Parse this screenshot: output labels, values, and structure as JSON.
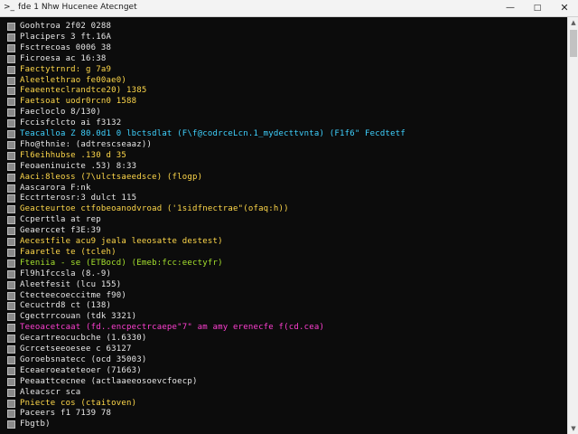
{
  "window": {
    "title": "fde 1 Nhw Hucenee Atecnget",
    "app_icon": "terminal-icon",
    "minimize_icon": "minimize-icon",
    "maximize_icon": "maximize-icon",
    "close_icon": "close-icon"
  },
  "terminal": {
    "lines": [
      {
        "text": "Goohtroa  2f02  0288",
        "color": "#e8e8e8"
      },
      {
        "text": "Placipers  3  ft.16A",
        "color": "#e8e8e8"
      },
      {
        "text": "Fsctrecoas  0006  38",
        "color": "#e8e8e8"
      },
      {
        "text": "Ficroesa  ac  16:38",
        "color": "#e8e8e8"
      },
      {
        "text": "Faectytrnrd:  g  7a9",
        "color": "#ffd84a"
      },
      {
        "text": "Aleetlethrao  fe00ae0)",
        "color": "#ffd84a"
      },
      {
        "text": "Feaeenteclrandtce20)  1385",
        "color": "#ffd84a"
      },
      {
        "text": "Faetsoat  uodr0rcn0  1588",
        "color": "#ffd84a"
      },
      {
        "text": "Faecloclo  8/130)",
        "color": "#e8e8e8"
      },
      {
        "text": "Fccisfclcto  ai  f3132",
        "color": "#e8e8e8"
      },
      {
        "text": "Teacalloa  Z  80.0d1  0  lbctsdlat  (F\\f@codrceLcn.1_mydecttvnta)  (F1f6\"  Fecdtetf",
        "color": "#3fd2ff"
      },
      {
        "text": "Fho@thnie:  (adtrescseaaz))",
        "color": "#e8e8e8"
      },
      {
        "text": "Fl6eihhubse  .130  d  35",
        "color": "#ffd84a"
      },
      {
        "text": "Feoaeninuicte  .53)  8:33",
        "color": "#e8e8e8"
      },
      {
        "text": "Aaci:8leoss  (7\\ulctsaeedsce)  (flogp)",
        "color": "#ffd84a"
      },
      {
        "text": "Aascarora  F:nk",
        "color": "#e8e8e8"
      },
      {
        "text": "Ecctrterosr:3  dulct  115",
        "color": "#e8e8e8"
      },
      {
        "text": "Geacteurtoe  ctfobeoanodvroad  ('1sidfnectrae\"(ofaq:h))",
        "color": "#ffd84a"
      },
      {
        "text": "Ccperttla  at  rep",
        "color": "#e8e8e8"
      },
      {
        "text": "Geaerccet  f3E:39",
        "color": "#e8e8e8"
      },
      {
        "text": "Aecestfile  acu9  jeala  leeosatte  destest)",
        "color": "#ffd84a"
      },
      {
        "text": "Faaretle  te  (tcleh)",
        "color": "#ffd84a"
      },
      {
        "text": "Fteniia  -  se  (ETBocd)  (Emeb:fcc:eectyfr)",
        "color": "#a6e22e"
      },
      {
        "text": "Fl9h1fccsla  (8.-9)",
        "color": "#e8e8e8"
      },
      {
        "text": "Aleetfesit  (lcu  155)",
        "color": "#e8e8e8"
      },
      {
        "text": "Ctecteecoeccitme  f90)",
        "color": "#e8e8e8"
      },
      {
        "text": "Cecuctrd8  ct  (138)",
        "color": "#e8e8e8"
      },
      {
        "text": "Cgectrrcouan  (tdk  3321)",
        "color": "#e8e8e8"
      },
      {
        "text": "Teeoacetcaat  (fd..encpectrcaepe\"7\"  am  amy  erenecfe  f(cd.cea)",
        "color": "#ff3fd2"
      },
      {
        "text": "Gecartreocucbche  (1.6330)",
        "color": "#e8e8e8"
      },
      {
        "text": "Gcrcetseeoesee  c  63127",
        "color": "#e8e8e8"
      },
      {
        "text": "Goroebsnatecc  (ocd  35003)",
        "color": "#e8e8e8"
      },
      {
        "text": "Eceaeroeateteoer  (71663)",
        "color": "#e8e8e8"
      },
      {
        "text": "Peeaattcecnee  (actlaaeeosoevcfoecp)",
        "color": "#e8e8e8"
      },
      {
        "text": "Aleacscr  sca",
        "color": "#e8e8e8"
      },
      {
        "text": "Pniecte  cos  (ctaitoven)",
        "color": "#ffd84a"
      },
      {
        "text": "Paceers  f1  7139  78",
        "color": "#e8e8e8"
      },
      {
        "text": "Fbgtb)",
        "color": "#e8e8e8"
      }
    ]
  },
  "scrollbar": {
    "up_icon": "scroll-up-icon",
    "down_icon": "scroll-down-icon"
  }
}
